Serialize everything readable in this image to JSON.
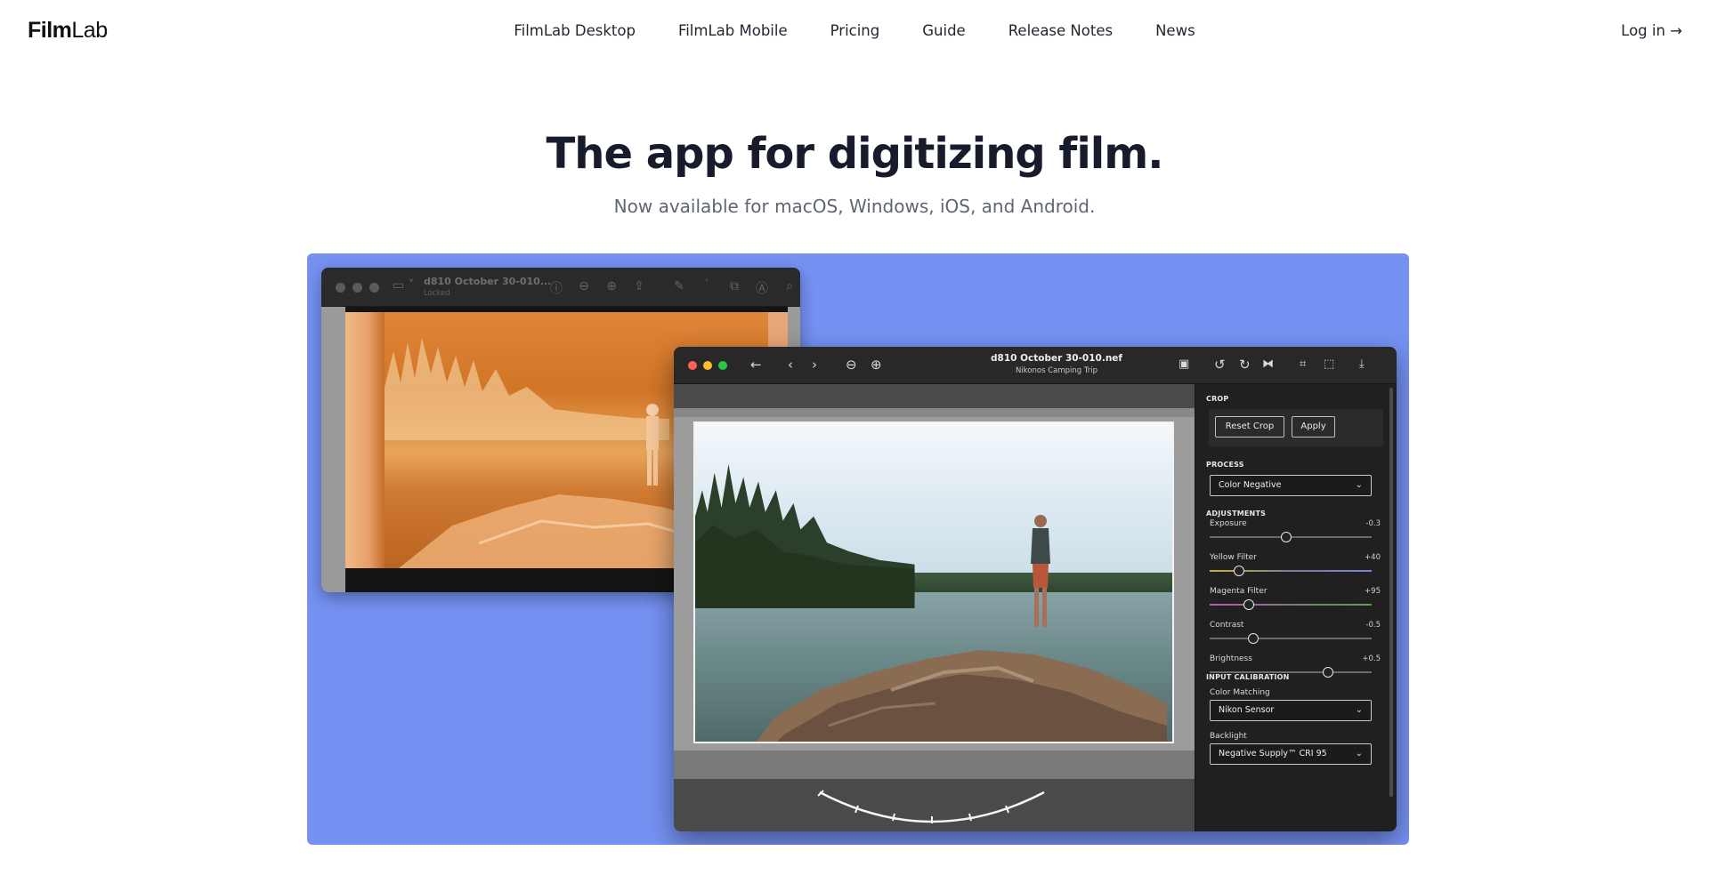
{
  "nav": {
    "logo_bold": "Film",
    "logo_light": "Lab",
    "links": [
      "FilmLab Desktop",
      "FilmLab Mobile",
      "Pricing",
      "Guide",
      "Release Notes",
      "News"
    ],
    "login": "Log in →"
  },
  "hero": {
    "title": "The app for digitizing film.",
    "subtitle": "Now available for macOS, Windows, iOS, and Android."
  },
  "colors": {
    "showcase_bg": "#7592f3",
    "dot_red": "#fe5f57",
    "dot_yellow": "#febc2e",
    "dot_green": "#28c840"
  },
  "back_window": {
    "title": "d810 October 30-010...",
    "subtitle": "Locked"
  },
  "front_window": {
    "title": "d810 October 30-010.nef",
    "subtitle": "Nikonos Camping Trip",
    "toolbar_icons": [
      "back-arrow-icon",
      "chevron-left-icon",
      "chevron-right-icon",
      "zoom-out-icon",
      "zoom-in-icon",
      "image-icon",
      "rotate-left-icon",
      "rotate-right-icon",
      "flip-icon",
      "crop-icon",
      "frame-icon",
      "export-icon"
    ]
  },
  "panel": {
    "crop": {
      "heading": "CROP",
      "reset_label": "Reset Crop",
      "apply_label": "Apply"
    },
    "process": {
      "heading": "PROCESS",
      "selected": "Color Negative"
    },
    "adjustments": {
      "heading": "ADJUSTMENTS",
      "sliders": [
        {
          "label": "Exposure",
          "value": "-0.3",
          "position": 0.47,
          "track": "gray"
        },
        {
          "label": "Yellow Filter",
          "value": "+40",
          "position": 0.18,
          "track": "yellow-blue"
        },
        {
          "label": "Magenta Filter",
          "value": "+95",
          "position": 0.24,
          "track": "magenta-green"
        },
        {
          "label": "Contrast",
          "value": "-0.5",
          "position": 0.27,
          "track": "gray"
        },
        {
          "label": "Brightness",
          "value": "+0.5",
          "position": 0.73,
          "track": "gray"
        }
      ]
    },
    "input_calibration": {
      "heading": "INPUT CALIBRATION",
      "color_matching_label": "Color Matching",
      "color_matching_selected": "Nikon Sensor",
      "backlight_label": "Backlight",
      "backlight_selected": "Negative Supply™ CRI 95"
    }
  }
}
